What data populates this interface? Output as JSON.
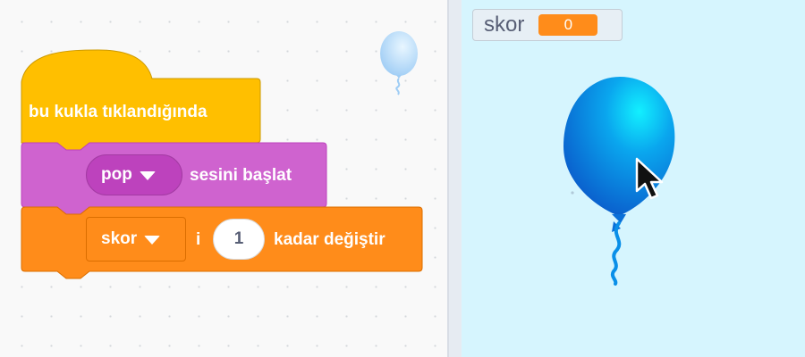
{
  "script": {
    "hat_block": {
      "label": "bu kukla tıklandığında"
    },
    "sound_block": {
      "menu_value": "pop",
      "label": "sesini başlat"
    },
    "change_block": {
      "variable_value": "skor",
      "connector": "i",
      "amount": "1",
      "label": "kadar değiştir"
    }
  },
  "stage": {
    "monitor": {
      "label": "skor",
      "value": "0"
    }
  },
  "colors": {
    "events": "#ffbf00",
    "sound": "#cf63cf",
    "variables": "#ff8c1a",
    "stage_bg": "#d6f5fe",
    "balloon": "#0a8fe8"
  },
  "icons": [
    "balloon-sprite-thumbnail",
    "balloon-sprite",
    "mouse-cursor-icon",
    "dropdown-caret-icon"
  ]
}
